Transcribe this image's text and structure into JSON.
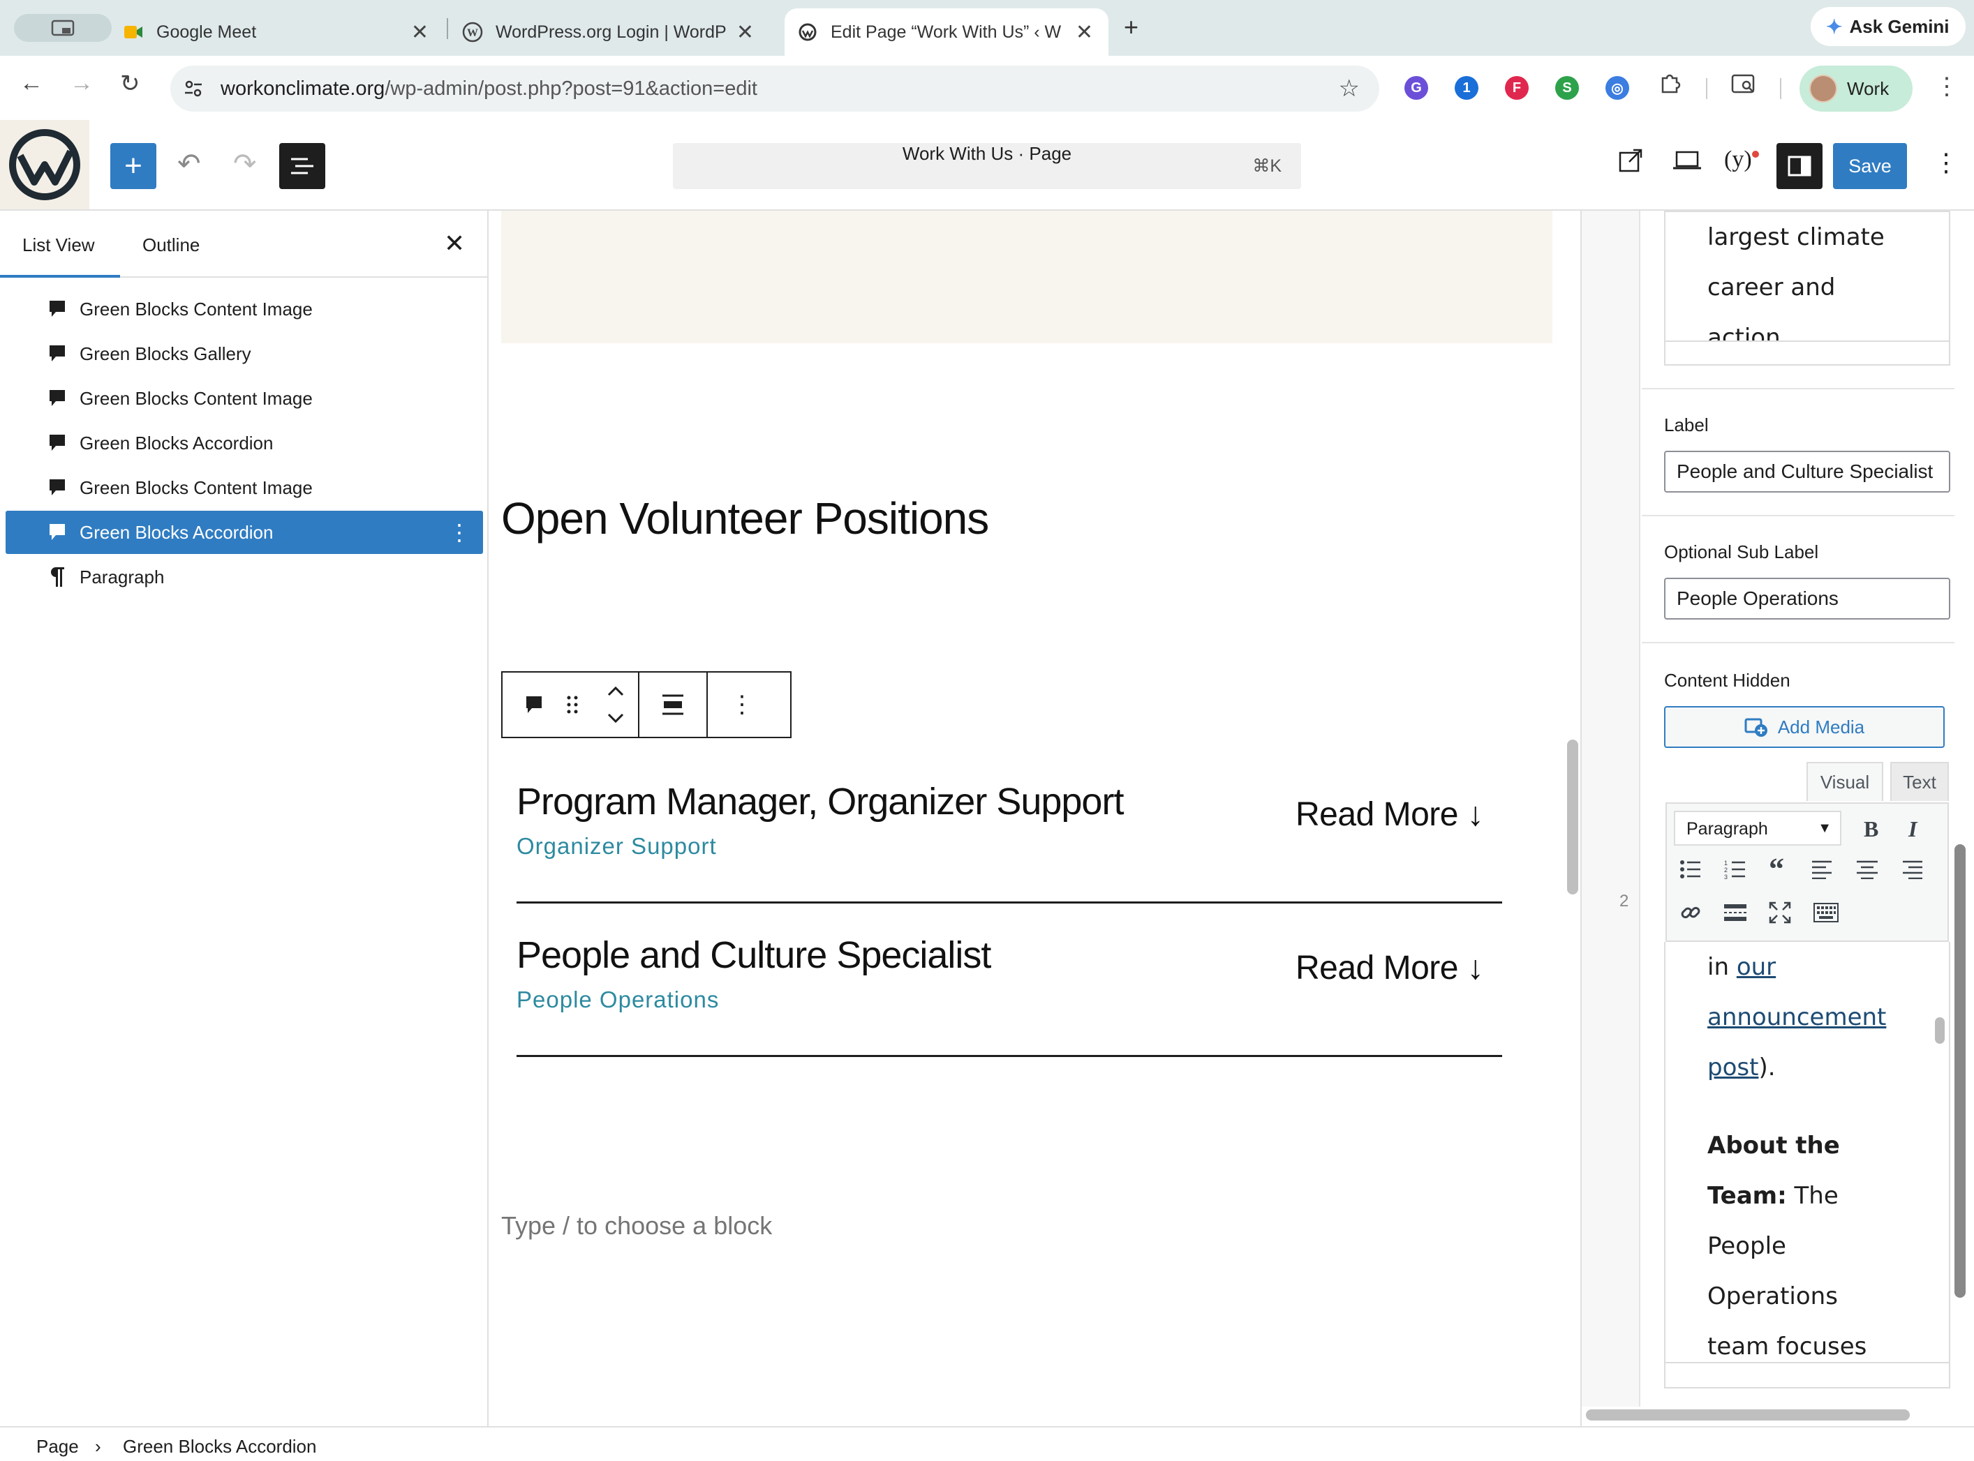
{
  "browser": {
    "tabs": [
      {
        "title": "Google Meet",
        "icon": "google-meet-icon"
      },
      {
        "title": "WordPress.org Login | WordP",
        "icon": "wordpress-icon"
      },
      {
        "title": "Edit Page “Work With Us” ‹ W",
        "icon": "workonclimate-icon",
        "active": true
      }
    ],
    "new_tab": "+",
    "ask_gemini": "Ask Gemini",
    "url_host": "workonclimate.org",
    "url_path": "/wp-admin/post.php?post=91&action=edit",
    "profile": "Work",
    "extensions": [
      {
        "icon": "grammarly-icon",
        "letter": "G",
        "color": "#6b4fd8"
      },
      {
        "icon": "onepassword-icon",
        "letter": "1",
        "color": "#1a6ed8"
      },
      {
        "icon": "flipboard-icon",
        "letter": "F",
        "color": "#e0284f"
      },
      {
        "icon": "s-extension-icon",
        "letter": "S",
        "color": "#2ea24a"
      },
      {
        "icon": "circle-extension-icon",
        "letter": "◎",
        "color": "#3b7de0"
      }
    ]
  },
  "editor": {
    "doc_title": "Work With Us · Page",
    "shortcut": "⌘K",
    "save": "Save"
  },
  "list_view": {
    "tabs": [
      "List View",
      "Outline"
    ],
    "items": [
      {
        "label": "Green Blocks Content Image",
        "icon": "comment-icon"
      },
      {
        "label": "Green Blocks Gallery",
        "icon": "comment-icon"
      },
      {
        "label": "Green Blocks Content Image",
        "icon": "comment-icon"
      },
      {
        "label": "Green Blocks Accordion",
        "icon": "comment-icon"
      },
      {
        "label": "Green Blocks Content Image",
        "icon": "comment-icon"
      },
      {
        "label": "Green Blocks Accordion",
        "icon": "comment-icon",
        "selected": true
      },
      {
        "label": "Paragraph",
        "icon": "pilcrow-icon"
      }
    ]
  },
  "canvas": {
    "heading": "Open Volunteer Positions",
    "accordion": [
      {
        "title": "Program Manager, Organizer Support",
        "sub": "Organizer Support",
        "read_more": "Read More ↓"
      },
      {
        "title": "People and Culture Specialist",
        "sub": "People Operations",
        "read_more": "Read More ↓"
      }
    ],
    "placeholder": "Type / to choose a block"
  },
  "sidebar": {
    "top_text": [
      "largest climate",
      "career and",
      "action"
    ],
    "label_title": "Label",
    "label_value": "People and Culture Specialist",
    "sublabel_title": "Optional Sub Label",
    "sublabel_value": "People Operations",
    "content_hidden_title": "Content Hidden",
    "add_media": "Add Media",
    "visual_tab": "Visual",
    "text_tab": "Text",
    "format_select": "Paragraph",
    "gutter_number": "2",
    "editor_text": {
      "line1_prefix": "in ",
      "line1_link": "our",
      "line2_link": "announcement",
      "line3_link": "post",
      "line3_suffix": ").",
      "about_bold_1": "About the",
      "about_bold_2": "Team:",
      "about_rest_2": " The",
      "line_people": "People",
      "line_operations": "Operations",
      "line_team": "team focuses"
    }
  },
  "breadcrumb": [
    "Page",
    "Green Blocks Accordion"
  ]
}
